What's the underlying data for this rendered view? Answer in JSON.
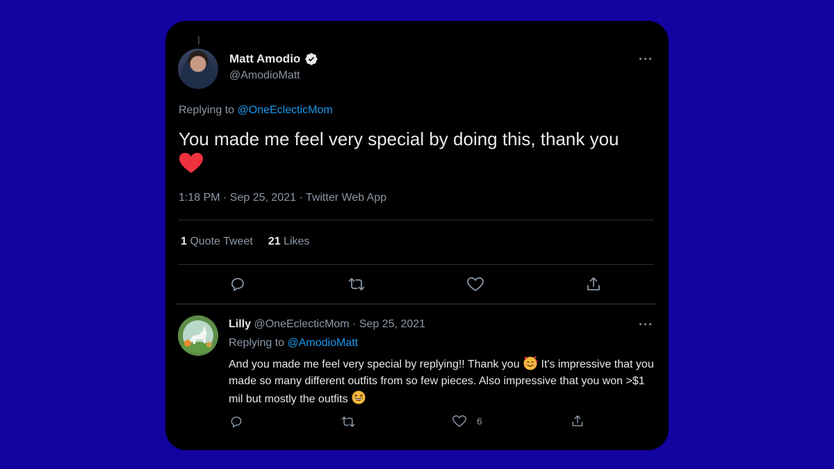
{
  "colors": {
    "background": "#1303a0",
    "card": "#000000",
    "text_primary": "#e7e9ea",
    "text_secondary": "#8b98a5",
    "link": "#1d9bf0",
    "verified_badge": "#e7e9ea",
    "heart": "#f0313e"
  },
  "main_tweet": {
    "display_name": "Matt Amodio",
    "handle": "@AmodioMatt",
    "replying_prefix": "Replying to",
    "replying_mention": "@OneEclecticMom",
    "text": "You made me feel very special by doing this, thank you",
    "text_emoji": "red-heart-emoji",
    "meta": "1:18 PM · Sep 25, 2021 · Twitter Web App",
    "quote_count": "1",
    "quote_label": "Quote Tweet",
    "likes_count": "21",
    "likes_label": "Likes",
    "icons": [
      "reply-icon",
      "retweet-icon",
      "like-icon",
      "share-icon"
    ]
  },
  "reply_tweet": {
    "display_name": "Lilly",
    "handle": "@OneEclecticMom",
    "date": "· Sep 25, 2021",
    "replying_prefix": "Replying to",
    "replying_mention": "@AmodioMatt",
    "text_part1": "And you made me feel very special by replying!! Thank you",
    "text_part2": "It's impressive that you made so many different outfits from so few pieces. Also impressive that you won >$1 mil but mostly the outfits",
    "emojis": [
      "smiling-face-with-hearts-emoji",
      "grinning-squinting-face-emoji"
    ],
    "like_count": "6",
    "icons": [
      "reply-icon",
      "retweet-icon",
      "like-icon",
      "share-icon"
    ]
  }
}
